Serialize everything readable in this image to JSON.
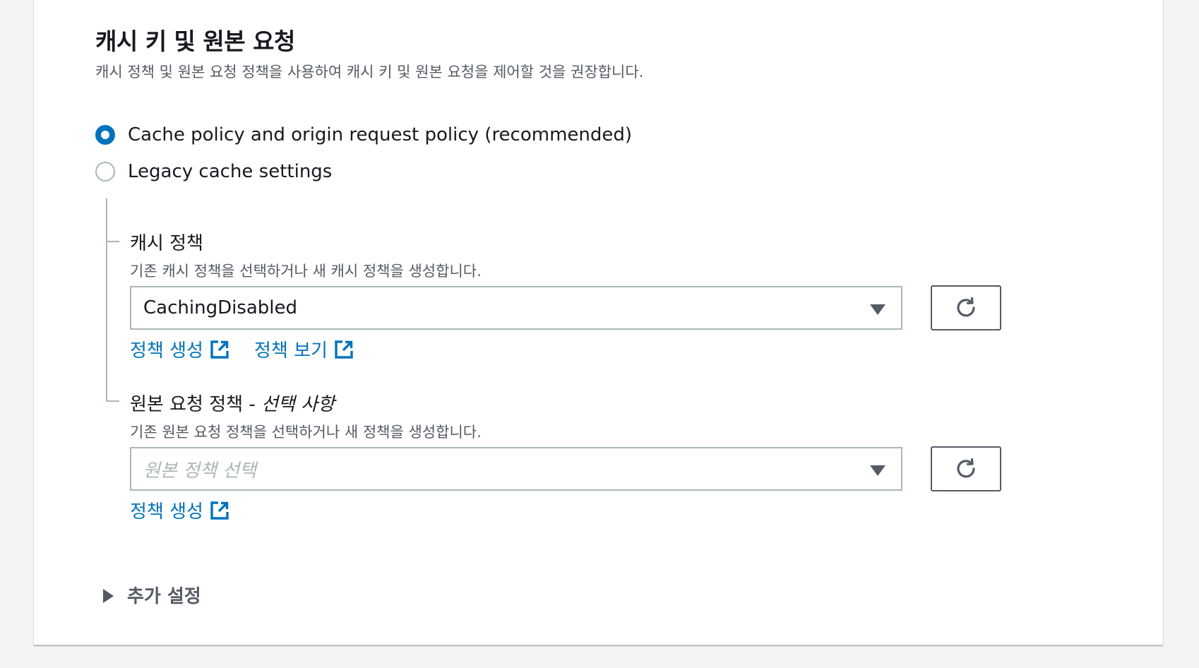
{
  "section": {
    "title": "캐시 키 및 원본 요청",
    "description": "캐시 정책 및 원본 요청 정책을 사용하여 캐시 키 및 원본 요청을 제어할 것을 권장합니다."
  },
  "radio_options": [
    {
      "label": "Cache policy and origin request policy (recommended)",
      "checked": true
    },
    {
      "label": "Legacy cache settings",
      "checked": false
    }
  ],
  "cache_policy": {
    "label": "캐시 정책",
    "description": "기존 캐시 정책을 선택하거나 새 캐시 정책을 생성합니다.",
    "selected_value": "CachingDisabled",
    "links": {
      "create": "정책 생성",
      "view": "정책 보기"
    }
  },
  "origin_request_policy": {
    "label": "원본 요청 정책 - ",
    "label_optional": "선택 사항",
    "description": "기존 원본 요청 정책을 선택하거나 새 정책을 생성합니다.",
    "placeholder": "원본 정책 선택",
    "links": {
      "create": "정책 생성"
    }
  },
  "additional_settings": {
    "label": "추가 설정",
    "expanded": false
  },
  "colors": {
    "link": "#0073bb",
    "radio_selected": "#0073bb",
    "text_secondary": "#545b64",
    "border": "#aab7b8"
  }
}
